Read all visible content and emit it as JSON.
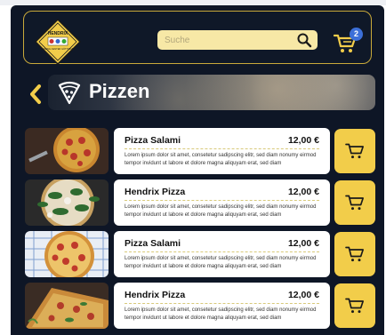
{
  "header": {
    "logo_text": "HENDRIX",
    "logo_subtext": "KARLING CENTER GÖTTINGEN",
    "search_placeholder": "Suche",
    "cart_count": "2"
  },
  "category": {
    "title": "Pizzen"
  },
  "products": [
    {
      "name": "Pizza Salami",
      "price": "12,00 €",
      "description": "Lorem ipsum dolor sit amet, consetetur sadipscing elitr, sed diam nonumy eirmod tempor invidunt ut labore et dolore magna aliquyam erat, sed diam"
    },
    {
      "name": "Hendrix Pizza",
      "price": "12,00 €",
      "description": "Lorem ipsum dolor sit amet, consetetur sadipscing elitr, sed diam nonumy eirmod tempor invidunt ut labore et dolore magna aliquyam erat, sed diam"
    },
    {
      "name": "Pizza Salami",
      "price": "12,00 €",
      "description": "Lorem ipsum dolor sit amet, consetetur sadipscing elitr, sed diam nonumy eirmod tempor invidunt ut labore et dolore magna aliquyam erat, sed diam"
    },
    {
      "name": "Hendrix Pizza",
      "price": "12,00 €",
      "description": "Lorem ipsum dolor sit amet, consetetur sadipscing elitr, sed diam nonumy eirmod tempor invidunt ut labore et dolore magna aliquyam erat, sed diam"
    }
  ],
  "colors": {
    "background": "#0e1626",
    "accent_yellow": "#f2cd4a",
    "search_bg": "#f7e8a6",
    "badge_blue": "#3c6fd8",
    "card_bg": "#ffffff"
  },
  "icons": {
    "logo": "hendrix-diamond-logo",
    "search": "magnifier-icon",
    "cart": "shopping-cart-icon",
    "back": "chevron-left-icon",
    "category": "pizza-slice-icon"
  }
}
